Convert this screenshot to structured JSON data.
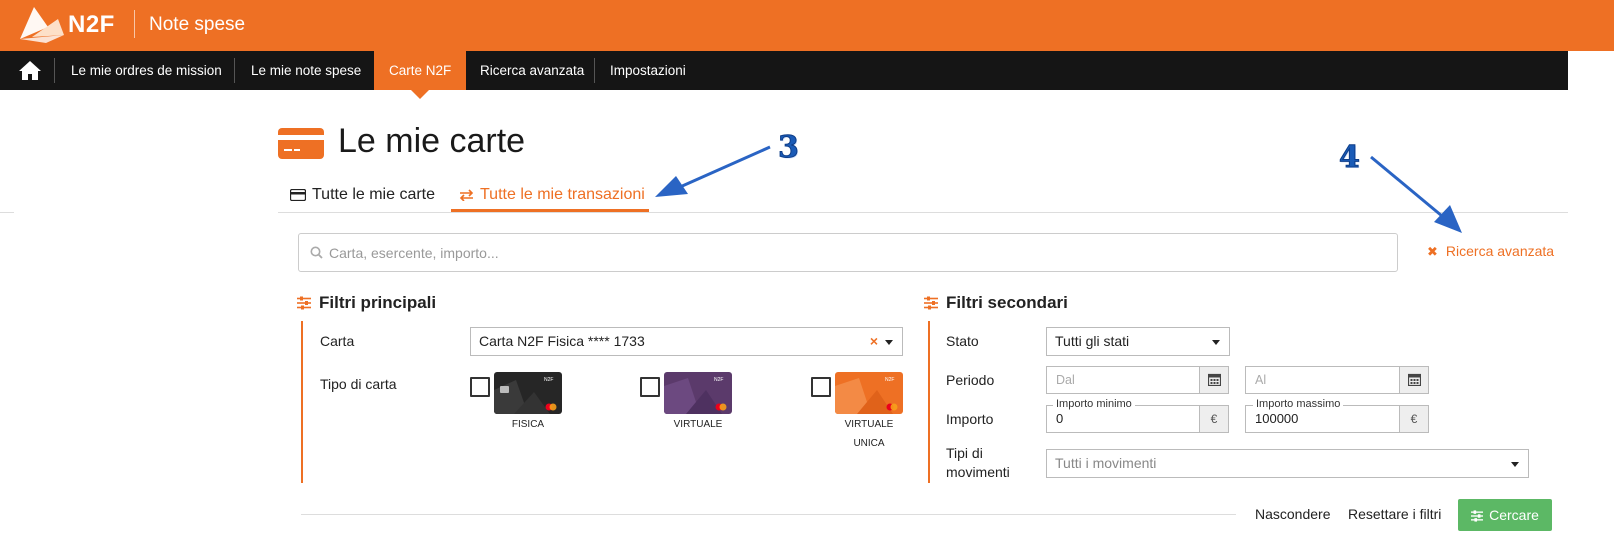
{
  "header": {
    "logo_text": "N2F",
    "app_title": "Note spese",
    "brand_color": "#ee7024"
  },
  "nav": {
    "home_icon": "home-icon",
    "items": [
      {
        "label": "Le mie ordres de mission"
      },
      {
        "label": "Le mie note spese"
      },
      {
        "label": "Carte N2F",
        "active": true
      },
      {
        "label": "Ricerca avanzata"
      },
      {
        "label": "Impostazioni"
      }
    ]
  },
  "page": {
    "title": "Le mie carte",
    "tabs": [
      {
        "label": "Tutte le mie carte",
        "icon": "credit-card-icon"
      },
      {
        "label": "Tutte le mie transazioni",
        "icon": "transfer-icon",
        "active": true
      }
    ]
  },
  "annotations": {
    "a3": "3",
    "a4": "4"
  },
  "search": {
    "placeholder": "Carta, esercente, importo...",
    "advanced_label": "Ricerca avanzata"
  },
  "filters_main": {
    "title": "Filtri principali",
    "card_label": "Carta",
    "card_value": "Carta N2F Fisica **** 1733",
    "card_type_label": "Tipo di carta",
    "card_types": [
      {
        "label": "FISICA",
        "color": "#262626"
      },
      {
        "label": "VIRTUALE",
        "color": "#5b3a6b"
      },
      {
        "label_line1": "VIRTUALE",
        "label_line2": "UNICA",
        "color": "#ee7024"
      }
    ]
  },
  "filters_secondary": {
    "title": "Filtri secondari",
    "stato_label": "Stato",
    "stato_value": "Tutti gli stati",
    "periodo_label": "Periodo",
    "dal_placeholder": "Dal",
    "al_placeholder": "Al",
    "importo_label": "Importo",
    "min_label": "Importo minimo",
    "min_value": "0",
    "max_label": "Importo massimo",
    "max_value": "100000",
    "currency": "€",
    "movimenti_label_line1": "Tipi di",
    "movimenti_label_line2": "movimenti",
    "movimenti_value": "Tutti i movimenti"
  },
  "actions": {
    "hide": "Nascondere",
    "reset": "Resettare i filtri",
    "search": "Cercare"
  },
  "colors": {
    "accent": "#ee7024",
    "success": "#5cb865",
    "annotation": "#1a5bb7"
  }
}
